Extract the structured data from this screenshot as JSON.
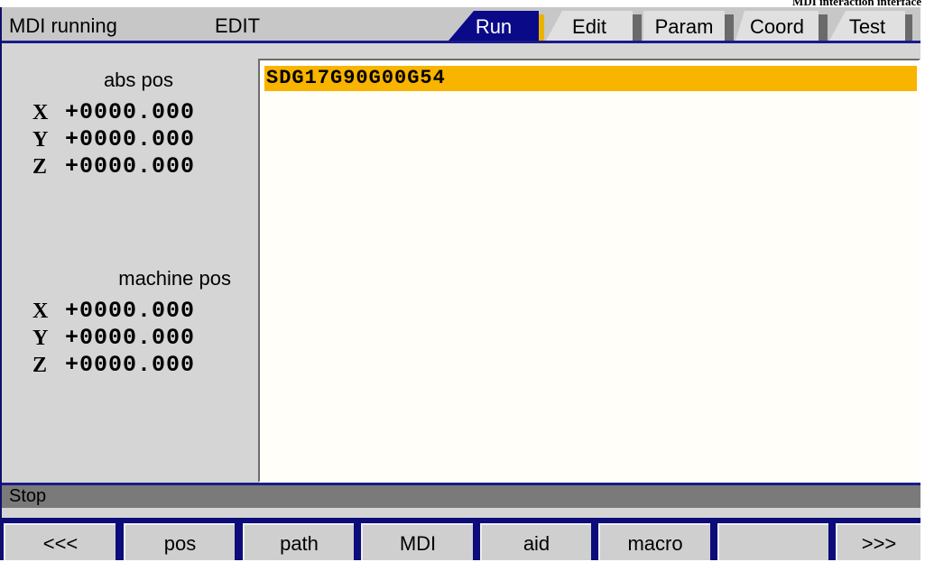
{
  "caption": "MDI interaction interface",
  "status": {
    "mode": "MDI running",
    "submode": "EDIT"
  },
  "tabs": [
    {
      "label": "Run",
      "active": true
    },
    {
      "label": "Edit",
      "active": false
    },
    {
      "label": "Param",
      "active": false
    },
    {
      "label": "Coord",
      "active": false
    },
    {
      "label": "Test",
      "active": false
    }
  ],
  "abs_pos": {
    "title": "abs pos",
    "rows": [
      {
        "axis": "X",
        "value": "+0000.000"
      },
      {
        "axis": "Y",
        "value": "+0000.000"
      },
      {
        "axis": "Z",
        "value": "+0000.000"
      }
    ]
  },
  "machine_pos": {
    "title": "machine pos",
    "rows": [
      {
        "axis": "X",
        "value": "+0000.000"
      },
      {
        "axis": "Y",
        "value": "+0000.000"
      },
      {
        "axis": "Z",
        "value": "+0000.000"
      }
    ]
  },
  "editor": {
    "current_line": "SDG17G90G00G54"
  },
  "message": "Stop",
  "softkeys": [
    "<<<",
    "pos",
    "path",
    "MDI",
    "aid",
    "macro",
    "",
    ">>>"
  ],
  "colors": {
    "accent": "#0a0a88",
    "highlight": "#f9b400",
    "panel": "#d5d5d5"
  }
}
